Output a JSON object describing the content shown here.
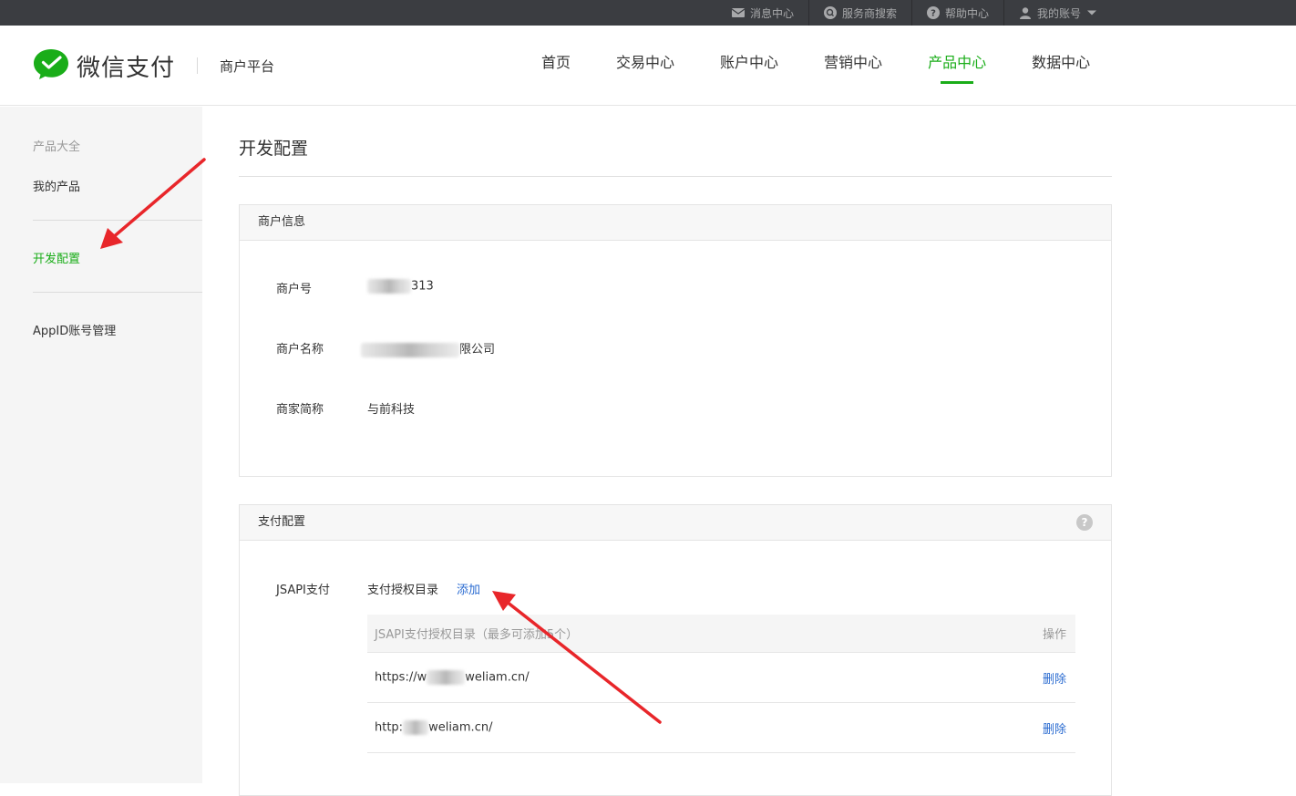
{
  "topbar": {
    "links": [
      {
        "label": "消息中心",
        "icon": "mail-icon"
      },
      {
        "label": "服务商搜索",
        "icon": "search-circle-icon"
      },
      {
        "label": "帮助中心",
        "icon": "help-circle-icon"
      },
      {
        "label": "我的账号",
        "icon": "user-icon"
      }
    ]
  },
  "header": {
    "logo_text": "微信支付",
    "sub_title": "商户平台",
    "nav": [
      {
        "label": "首页"
      },
      {
        "label": "交易中心"
      },
      {
        "label": "账户中心"
      },
      {
        "label": "营销中心"
      },
      {
        "label": "产品中心",
        "active": true
      },
      {
        "label": "数据中心"
      }
    ],
    "accent_color": "#1aad19"
  },
  "sidebar": {
    "title": "产品大全",
    "items": [
      {
        "label": "我的产品"
      },
      {
        "label": "开发配置",
        "active": true
      },
      {
        "label": "AppID账号管理"
      }
    ]
  },
  "main": {
    "title": "开发配置",
    "merchant_panel": {
      "title": "商户信息",
      "rows": [
        {
          "label": "商户号",
          "value_suffix": "313"
        },
        {
          "label": "商户名称",
          "value_suffix": "限公司"
        },
        {
          "label": "商家简称",
          "value": "与前科技"
        }
      ]
    },
    "pay_panel": {
      "title": "支付配置",
      "help_icon": "?",
      "jsapi_label": "JSAPI支付",
      "auth_dir_label": "支付授权目录",
      "add_label": "添加",
      "table_header": "JSAPI支付授权目录（最多可添加5个）",
      "table_action_header": "操作",
      "rows": [
        {
          "prefix": "https://w",
          "suffix": "weliam.cn/",
          "action": "删除"
        },
        {
          "prefix": "http:",
          "suffix": "weliam.cn/",
          "action": "删除"
        }
      ]
    }
  }
}
